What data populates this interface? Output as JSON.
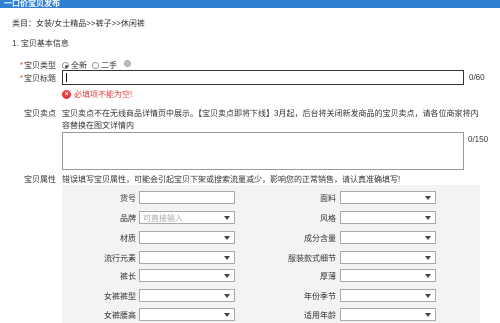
{
  "header": {
    "title": "一口价宝贝发布"
  },
  "breadcrumb": "类目：女装/女士精品>>裤子>>休闲裤",
  "section_title": "1. 宝贝基本信息",
  "item_type": {
    "label": "宝贝类型",
    "options": [
      {
        "label": "全新",
        "selected": true
      },
      {
        "label": "二手",
        "selected": false
      }
    ]
  },
  "item_title": {
    "label": "宝贝标题",
    "value": "",
    "counter": "0/60",
    "error": "必填项不能为空!"
  },
  "selling_point": {
    "label": "宝贝卖点",
    "description": "宝贝卖点不在无线商品详情页中展示。【宝贝卖点即将下线】3月起，后台将关闭新发商品的宝贝卖点，请各位商家将内容替换在图文详情内",
    "value": "",
    "counter": "0/150"
  },
  "attributes": {
    "label": "宝贝属性",
    "hint": "错误填写宝贝属性，可能会引起宝贝下架或搜索流量减少，影响您的正常销售，请认真准确填写!",
    "left": [
      {
        "label": "货号",
        "type": "text",
        "placeholder": ""
      },
      {
        "label": "品牌",
        "type": "select",
        "placeholder": "可直接输入"
      },
      {
        "label": "材质",
        "type": "select",
        "placeholder": ""
      },
      {
        "label": "流行元素",
        "type": "select",
        "placeholder": ""
      },
      {
        "label": "裤长",
        "type": "select",
        "placeholder": ""
      },
      {
        "label": "女裤裤型",
        "type": "select",
        "placeholder": ""
      },
      {
        "label": "女裤腰高",
        "type": "select",
        "placeholder": ""
      }
    ],
    "right": [
      {
        "label": "面料",
        "type": "select"
      },
      {
        "label": "风格",
        "type": "select"
      },
      {
        "label": "成分含量",
        "type": "select"
      },
      {
        "label": "服装款式细节",
        "type": "select"
      },
      {
        "label": "厚薄",
        "type": "select"
      },
      {
        "label": "年份季节",
        "type": "select"
      },
      {
        "label": "适用年龄",
        "type": "select"
      }
    ]
  },
  "colors": {
    "header_bg": "#2f7fd4",
    "required": "#ff4400",
    "error": "#e4393c",
    "panel_bg": "#f3f3f3"
  }
}
